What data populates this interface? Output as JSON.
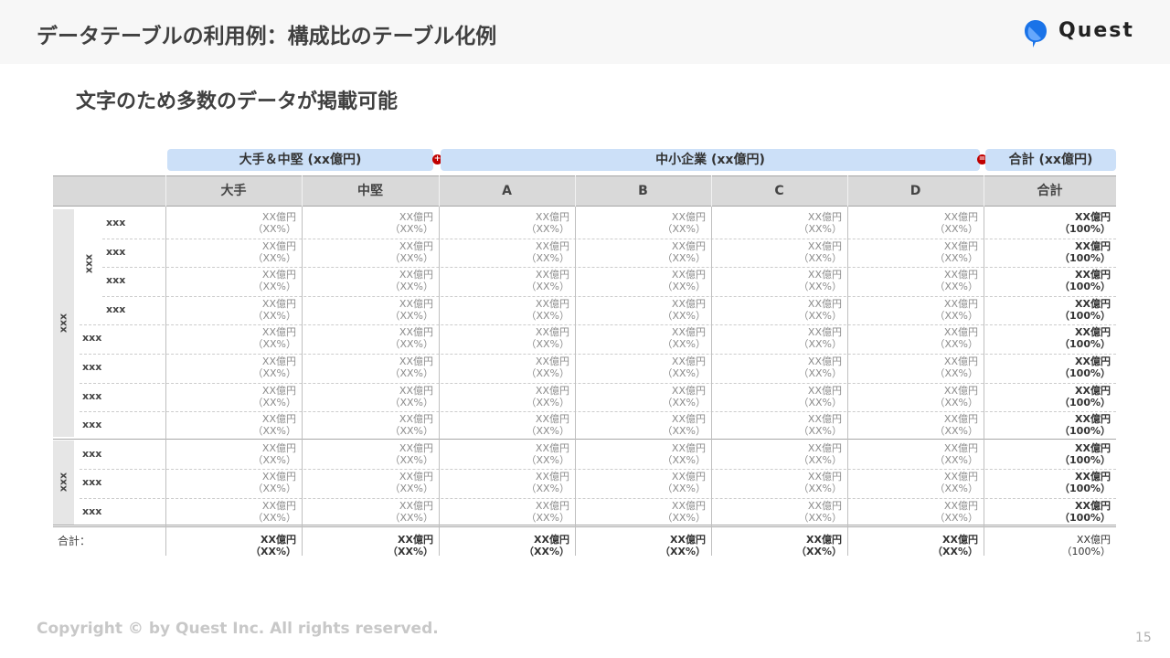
{
  "header": {
    "title": "データテーブルの利用例：構成比のテーブル化例",
    "logo_text": "Quest"
  },
  "subtitle": "文字のため多数のデータが掲載可能",
  "groups": {
    "large_mid": "大手＆中堅 (xx億円)",
    "sme": "中小企業 (xx億円)",
    "total": "合計 (xx億円)",
    "plus": "+",
    "minus": "="
  },
  "columns": [
    "大手",
    "中堅",
    "A",
    "B",
    "C",
    "D",
    "合計"
  ],
  "bands": {
    "outer": "xxx",
    "inner": "xxx",
    "second": "xxx"
  },
  "rows": [
    {
      "label": "xxx"
    },
    {
      "label": "xxx"
    },
    {
      "label": "xxx"
    },
    {
      "label": "xxx"
    },
    {
      "label": "xxx"
    },
    {
      "label": "xxx"
    },
    {
      "label": "xxx"
    },
    {
      "label": "xxx"
    },
    {
      "label": "xxx"
    },
    {
      "label": "xxx"
    },
    {
      "label": "xxx"
    }
  ],
  "cell_value": "XX億円",
  "cell_pct": "（XX%）",
  "total_value": "XX億円",
  "total_pct": "（100%）",
  "sum": {
    "label": "合計：",
    "value": "XX億円",
    "pct": "（XX%）",
    "total_value": "XX億円",
    "total_pct": "（100%）"
  },
  "footer": {
    "copyright": "Copyright © by Quest Inc. All rights reserved.",
    "page_number": "15"
  },
  "colors": {
    "accent": "#cce0f8",
    "operator": "#c00000",
    "logo_blue": "#1a73e8"
  }
}
